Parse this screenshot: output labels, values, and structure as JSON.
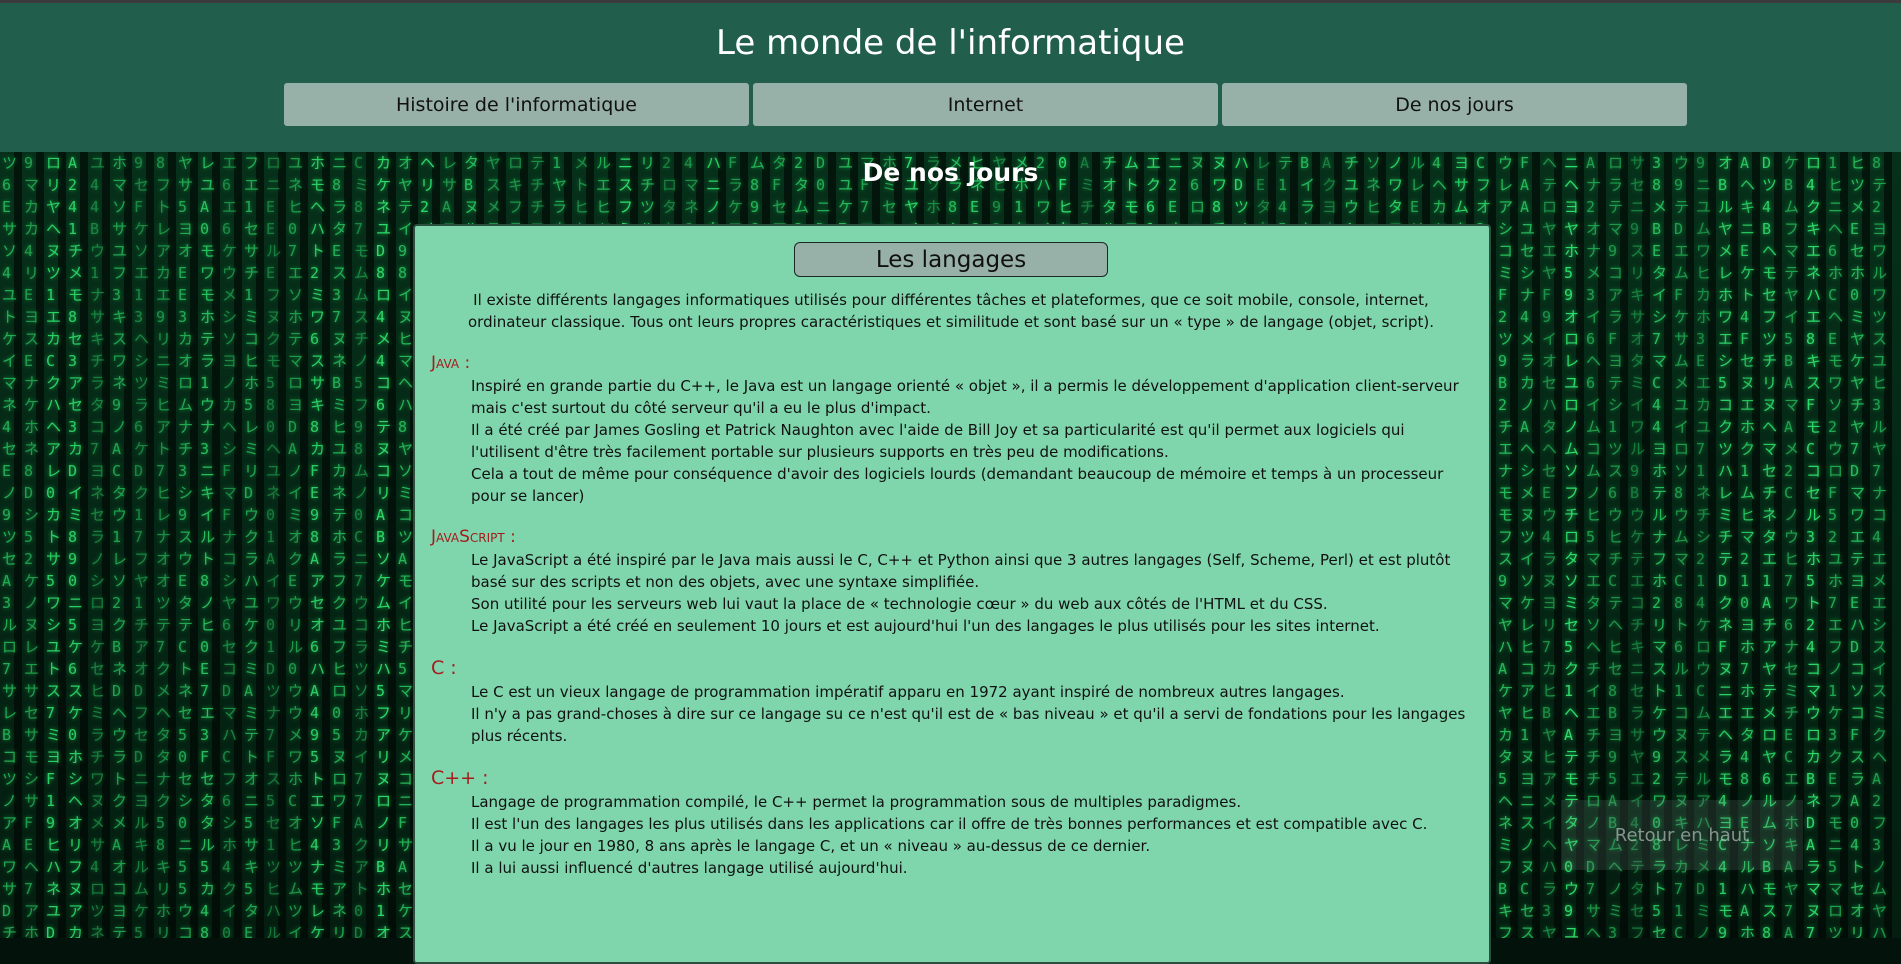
{
  "header": {
    "title": "Le monde de l'informatique",
    "nav": [
      {
        "label": "Histoire de l'informatique"
      },
      {
        "label": "Internet"
      },
      {
        "label": "De nos jours"
      }
    ]
  },
  "section": {
    "title": "De nos jours"
  },
  "article": {
    "title": "Les langages",
    "intro": "Il existe différents langages informatiques utilisés pour différentes tâches et plateformes, que ce soit mobile, console, internet, ordinateur classique. Tous ont leurs propres caractéristiques et similitude et sont basé sur un « type » de langage (objet, script).",
    "languages": [
      {
        "name": "Java :",
        "paragraphs": [
          "Inspiré en grande partie du C++, le Java est un langage orienté « objet », il a permis le développement d'application client-serveur mais c'est surtout du côté serveur qu'il a eu le plus d'impact.",
          "Il a été créé par James Gosling et Patrick Naughton avec l'aide de Bill Joy et sa particularité est qu'il permet aux logiciels qui l'utilisent d'être très facilement portable sur plusieurs supports en très peu de modifications.",
          "Cela a tout de même pour conséquence d'avoir des logiciels lourds (demandant beaucoup de mémoire et temps à un processeur pour se lancer)"
        ]
      },
      {
        "name": "JavaScript :",
        "paragraphs": [
          "Le JavaScript a été inspiré par le Java mais aussi le C, C++ et Python ainsi que 3 autres langages (Self, Scheme, Perl) et est plutôt basé sur des scripts et non des objets, avec une syntaxe simplifiée.",
          "Son utilité pour les serveurs web lui vaut la place de « technologie cœur » du web aux côtés de l'HTML et du CSS.",
          "Le JavaScript a été créé en seulement 10 jours et est aujourd'hui l'un des langages le plus utilisés pour les sites internet."
        ]
      },
      {
        "name": "C :",
        "paragraphs": [
          "Le C est un vieux langage de programmation impératif apparu en 1972 ayant inspiré de nombreux autres langages.",
          "Il n'y a pas grand-choses à dire sur ce langage su ce n'est qu'il est de « bas niveau » et qu'il a servi de fondations pour les langages plus récents."
        ]
      },
      {
        "name": "C++ :",
        "paragraphs": [
          "Langage de programmation compilé, le C++ permet la programmation sous de multiples paradigmes.",
          "Il est l'un des langages les plus utilisés dans les applications car il offre de très bonnes performances et est compatible avec C.",
          "Il a vu le jour en 1980, 8 ans après le langage C, et un « niveau » au-dessus de ce dernier.",
          "Il a lui aussi influencé d'autres langage utilisé aujourd'hui."
        ]
      }
    ]
  },
  "back_to_top": {
    "label": "Retour en haut"
  },
  "colors": {
    "header_bg": "#215e4c",
    "nav_bg": "#97b0a8",
    "content_bg": "#7fd6ad",
    "lang_name": "#a51c1c",
    "matrix_green": "#2ee06b"
  }
}
